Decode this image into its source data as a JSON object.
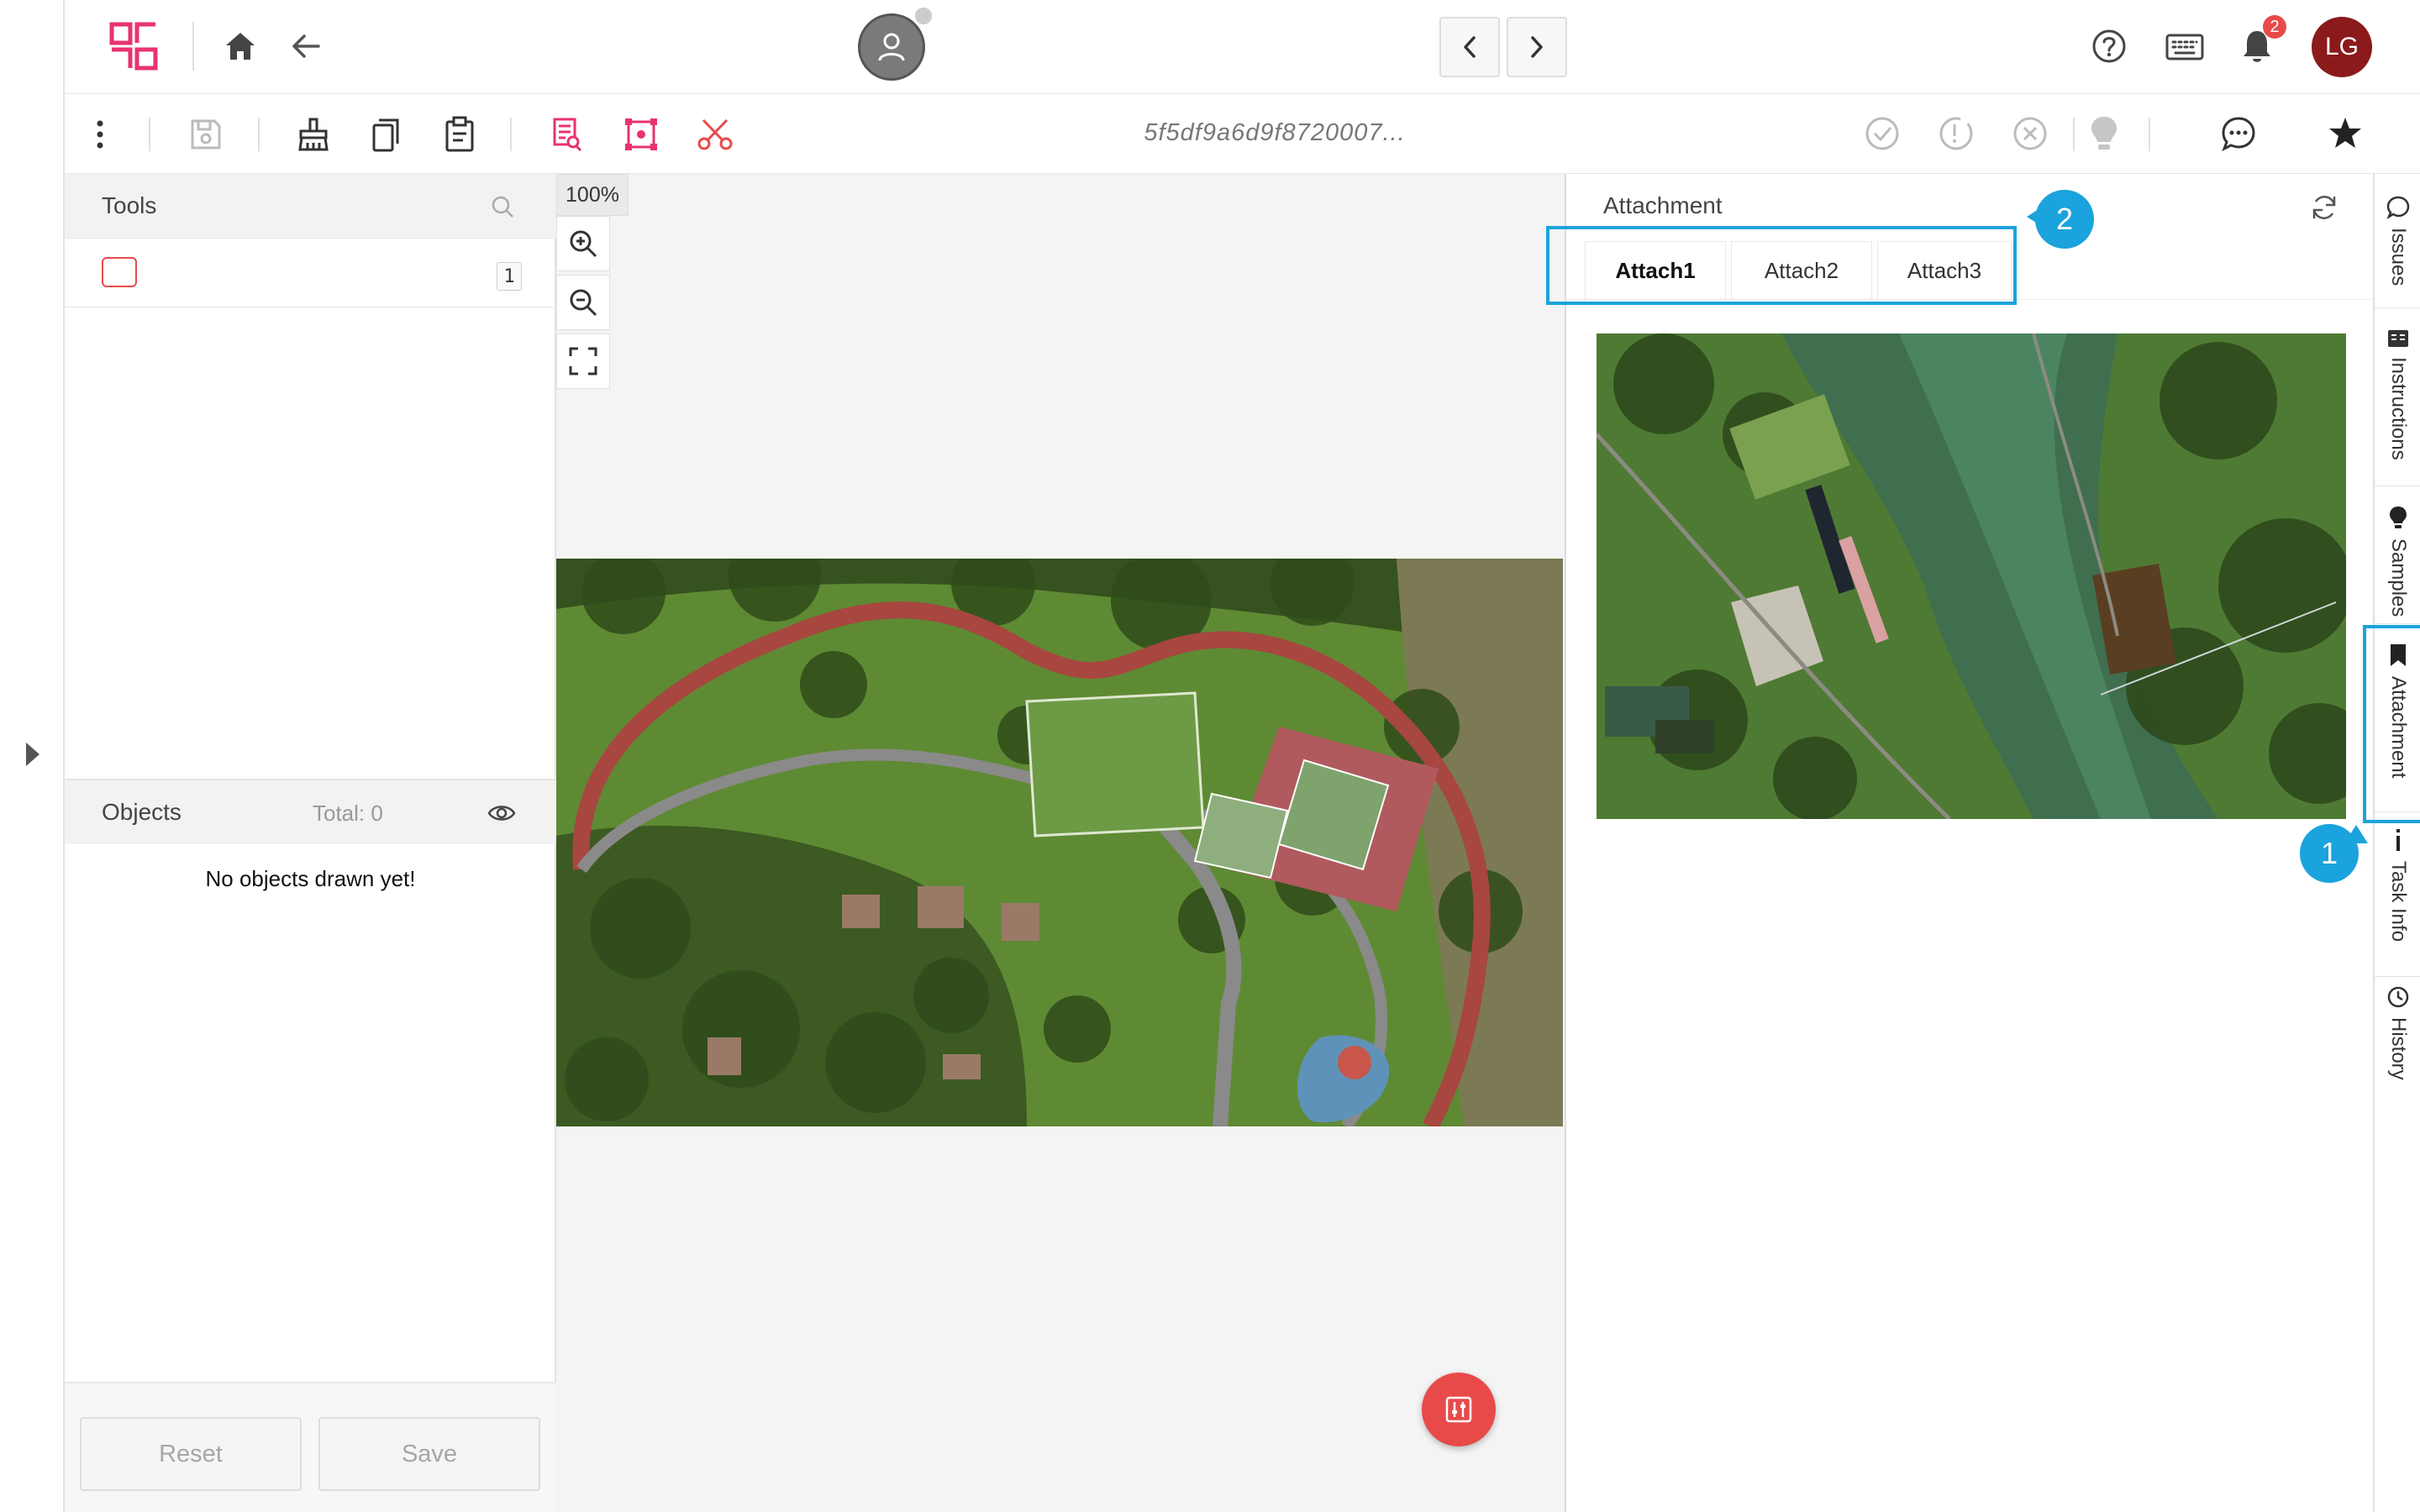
{
  "toolbar": {
    "task_id": "5f5df9a6d9f8720007..."
  },
  "topbar": {
    "notification_count": "2",
    "avatar_initials": "LG"
  },
  "tools_panel": {
    "title": "Tools",
    "tools": [
      {
        "shortcut": "1"
      }
    ]
  },
  "objects_panel": {
    "title": "Objects",
    "total": "Total: 0",
    "empty_text": "No objects drawn yet!"
  },
  "buttons": {
    "reset": "Reset",
    "save": "Save"
  },
  "canvas": {
    "zoom": "100%"
  },
  "attachment_panel": {
    "title": "Attachment",
    "tabs": [
      {
        "label": "Attach1",
        "active": true
      },
      {
        "label": "Attach2",
        "active": false
      },
      {
        "label": "Attach3",
        "active": false
      }
    ]
  },
  "right_rail": {
    "items": [
      {
        "label": "Issues",
        "icon": "chat-icon"
      },
      {
        "label": "Instructions",
        "icon": "book-icon"
      },
      {
        "label": "Samples",
        "icon": "bulb-icon"
      },
      {
        "label": "Attachment",
        "icon": "bookmark-icon",
        "active": true
      },
      {
        "label": "Task Info",
        "icon": "info-icon"
      },
      {
        "label": "History",
        "icon": "clock-icon"
      }
    ]
  },
  "callouts": {
    "one": "1",
    "two": "2"
  },
  "colors": {
    "brand": "#e8336e",
    "accent": "#1aa3dc",
    "danger": "#e84a4a",
    "avatar_bg": "#8b1a1a"
  }
}
